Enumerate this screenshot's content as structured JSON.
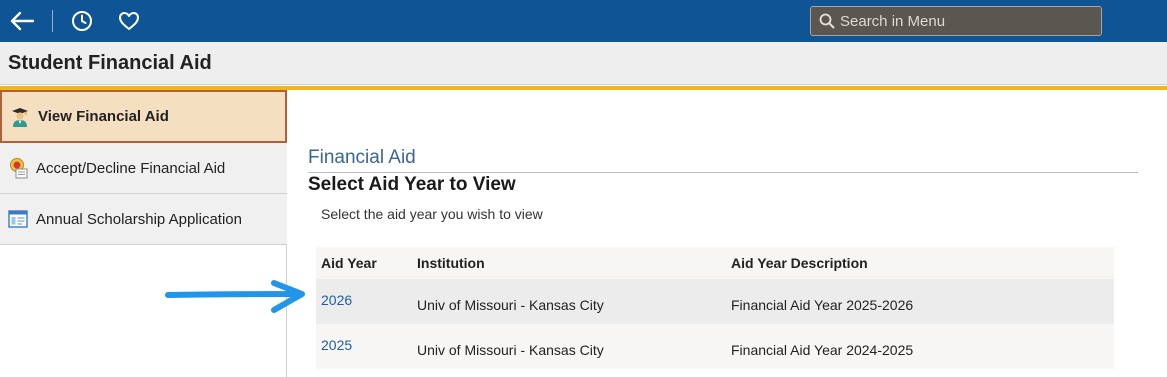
{
  "topbar": {
    "back_icon": "arrow-left-icon",
    "history_icon": "clock-icon",
    "favorites_icon": "heart-icon",
    "search_placeholder": "Search in Menu"
  },
  "page": {
    "title": "Student Financial Aid"
  },
  "sidebar": {
    "items": [
      {
        "label": "View Financial Aid",
        "icon": "graduate-icon",
        "active": true
      },
      {
        "label": "Accept/Decline Financial Aid",
        "icon": "award-ribbon-icon",
        "active": false
      },
      {
        "label": "Annual Scholarship Application",
        "icon": "form-window-icon",
        "active": false
      }
    ]
  },
  "main": {
    "kicker": "Financial Aid",
    "title": "Select Aid Year to View",
    "instruction": "Select the aid year you wish to view",
    "table": {
      "headers": {
        "aid_year": "Aid Year",
        "institution": "Institution",
        "description": "Aid Year Description"
      },
      "rows": [
        {
          "aid_year": "2026",
          "institution": "Univ of Missouri - Kansas City",
          "description": "Financial Aid Year 2025-2026"
        },
        {
          "aid_year": "2025",
          "institution": "Univ of Missouri - Kansas City",
          "description": "Financial Aid Year 2024-2025"
        }
      ]
    }
  },
  "colors": {
    "topbar": "#0f5596",
    "accent_gold": "#f4b51c",
    "link": "#1f5fa3",
    "annotation_arrow": "#2196e8"
  }
}
